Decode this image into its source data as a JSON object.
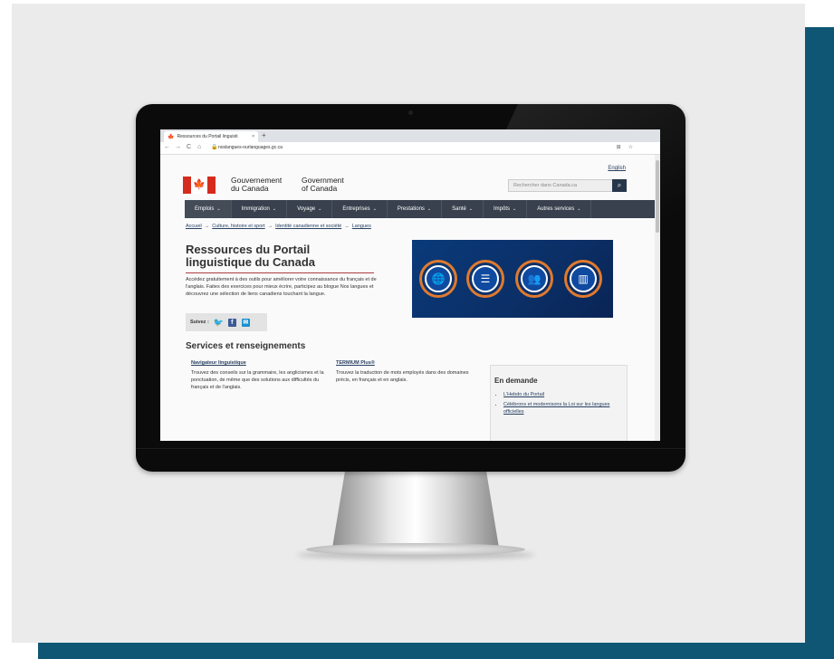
{
  "browser": {
    "tab_title": "Ressources du Portail linguisti",
    "tab_close": "×",
    "new_tab": "+",
    "url": "noslangues-ourlanguages.gc.ca",
    "back": "←",
    "forward": "→",
    "reload": "C",
    "home": "⌂",
    "lock": "🔒",
    "translate_icon": "⊞",
    "star_icon": "☆"
  },
  "header": {
    "language_toggle": "English",
    "wordmark_fr_1": "Gouvernement",
    "wordmark_fr_2": "du Canada",
    "wordmark_en_1": "Government",
    "wordmark_en_2": "of Canada",
    "search_placeholder": "Rechercher dans Canada.ca",
    "search_button": "🔍"
  },
  "menu": [
    {
      "label": "Emplois"
    },
    {
      "label": "Immigration"
    },
    {
      "label": "Voyage"
    },
    {
      "label": "Entreprises"
    },
    {
      "label": "Prestations"
    },
    {
      "label": "Santé"
    },
    {
      "label": "Impôts"
    },
    {
      "label": "Autres services"
    }
  ],
  "breadcrumb": {
    "items": [
      "Accueil",
      "Culture, histoire et sport",
      "Identité canadienne et société",
      "Langues"
    ],
    "separator": "→"
  },
  "main": {
    "title": "Ressources du Portail linguistique du Canada",
    "intro": "Accédez gratuitement à des outils pour améliorer votre connaissance du français et de l'anglais. Faites des exercices pour mieux écrire, participez au blogue Nos langues et découvrez une sélection de liens canadiens touchant la langue.",
    "follow_label": "Suivez :",
    "services_heading": "Services et renseignements",
    "services": [
      {
        "link": "Navigateur linguistique",
        "desc": "Trouvez des conseils sur la grammaire, les anglicismes et la ponctuation, de même que des solutions aux difficultés du français et de l'anglais."
      },
      {
        "link": "TERMIUM Plus®",
        "desc": "Trouvez la traduction de mots employés dans des domaines précis, en français et en anglais."
      }
    ]
  },
  "aside": {
    "heading": "En demande",
    "links": [
      "L'Hebdo du Portail",
      "Célébrons et modernisons la Loi sur les langues officielles"
    ]
  },
  "icons": {
    "flag": "maple-leaf-flag",
    "twitter": "twitter-icon",
    "facebook": "facebook-icon",
    "email": "email-icon"
  },
  "colors": {
    "backdrop_teal": "#0f5675",
    "backdrop_gray": "#ebebeb",
    "menu_bg": "#38414d",
    "link": "#284162",
    "canada_red": "#d52b1e",
    "title_rule": "#af3c43",
    "banner_ring": "#e07a2e"
  }
}
